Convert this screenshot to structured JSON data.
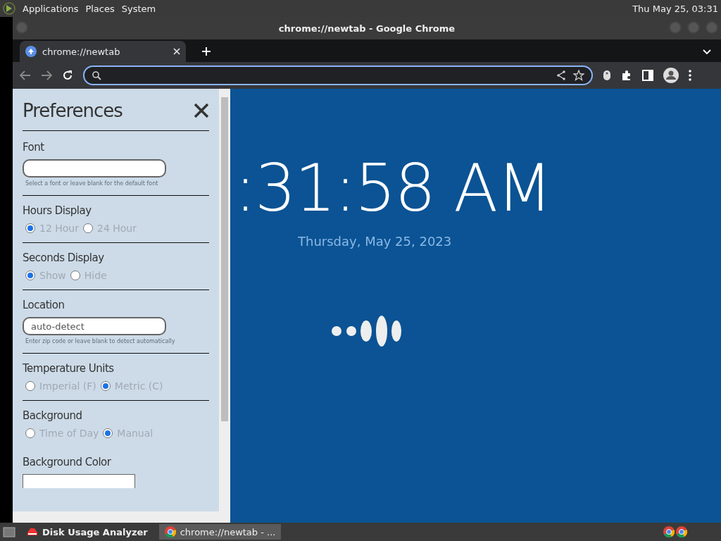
{
  "top_bar": {
    "menus": [
      "Applications",
      "Places",
      "System"
    ],
    "clock": "Thu May 25, 03:31"
  },
  "window": {
    "title": "chrome://newtab - Google Chrome"
  },
  "tabs": [
    {
      "label": "chrome://newtab",
      "selected": true
    }
  ],
  "preferences": {
    "title": "Preferences",
    "sections": [
      {
        "kind": "text",
        "label": "Font",
        "hint": "Select a font or leave blank for the default font"
      },
      {
        "kind": "radio",
        "label": "Hours Display",
        "options": [
          {
            "label": "12 Hour",
            "selected": true
          },
          {
            "label": "24 Hour",
            "selected": false
          }
        ]
      },
      {
        "kind": "radio",
        "label": "Seconds Display",
        "options": [
          {
            "label": "Show",
            "selected": true
          },
          {
            "label": "Hide",
            "selected": false
          }
        ]
      },
      {
        "kind": "text",
        "label": "Location",
        "value": "auto-detect",
        "hint": "Enter zip code or leave blank to detect automatically"
      },
      {
        "kind": "radio",
        "label": "Temperature Units",
        "options": [
          {
            "label": "Imperial (F)",
            "selected": false
          },
          {
            "label": "Metric (C)",
            "selected": true
          }
        ]
      },
      {
        "kind": "radio",
        "label": "Background",
        "options": [
          {
            "label": "Time of Day",
            "selected": false
          },
          {
            "label": "Manual",
            "selected": true
          }
        ]
      },
      {
        "kind": "color",
        "label": "Background Color"
      }
    ]
  },
  "page": {
    "time": ":31:58 AM",
    "date": "Thursday, May 25, 2023"
  },
  "taskbar": {
    "items": [
      {
        "label": "Disk Usage Analyzer",
        "selected": false
      },
      {
        "label": "chrome://newtab - ...",
        "selected": true
      }
    ]
  }
}
